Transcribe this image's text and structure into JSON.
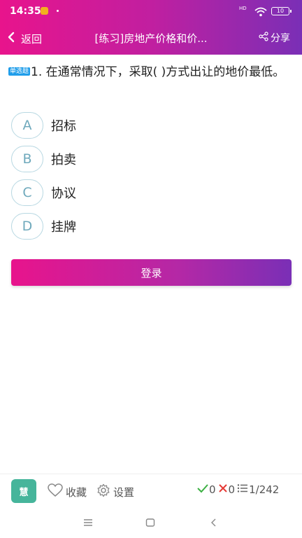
{
  "status_bar": {
    "time": "14:35",
    "network": "HD",
    "battery": "10"
  },
  "nav": {
    "back_label": "返回",
    "title": "[练习]房地产价格和价...",
    "share_label": "分享"
  },
  "question": {
    "type_badge": "单选题",
    "text": "1. 在通常情况下，采取( )方式出让的地价最低。"
  },
  "options": [
    {
      "letter": "A",
      "text": "招标"
    },
    {
      "letter": "B",
      "text": "拍卖"
    },
    {
      "letter": "C",
      "text": "协议"
    },
    {
      "letter": "D",
      "text": "挂牌"
    }
  ],
  "login_button": "登录",
  "toolbar": {
    "logo_text": "慧",
    "favorite_label": "收藏",
    "settings_label": "设置",
    "correct_count": "0",
    "wrong_count": "0",
    "progress": "1/242"
  },
  "colors": {
    "header_start": "#e8148c",
    "header_end": "#7a2fb6",
    "badge": "#1f9dea",
    "option_letter": "#6fa9bc",
    "correct": "#3cb043",
    "wrong": "#e53935"
  },
  "icons": {
    "back": "chevron-left-icon",
    "share": "share-icon",
    "favorite": "heart-icon",
    "settings": "gear-icon",
    "correct": "check-icon",
    "wrong": "close-icon",
    "list": "list-icon"
  }
}
